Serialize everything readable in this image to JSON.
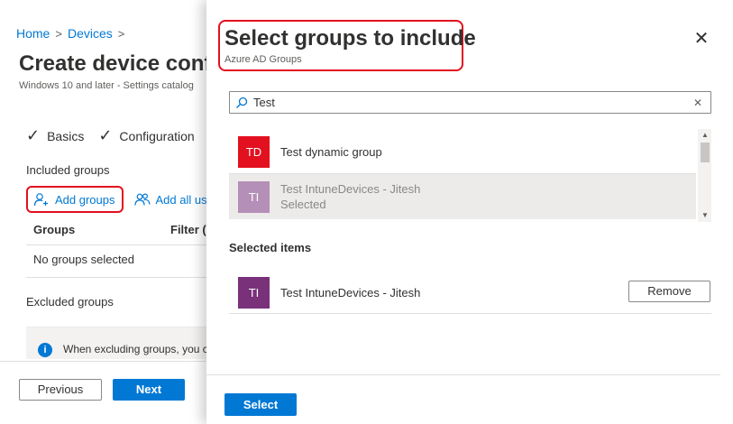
{
  "breadcrumb": {
    "home": "Home",
    "devices": "Devices",
    "sep": ">"
  },
  "page": {
    "title": "Create device confi",
    "subtitle": "Windows 10 and later - Settings catalog",
    "steps": [
      "Basics",
      "Configuration"
    ],
    "included_label": "Included groups",
    "add_groups_label": "Add groups",
    "add_all_label": "Add all use",
    "table_headers": [
      "Groups",
      "Filter (p"
    ],
    "no_groups_text": "No groups selected",
    "excluded_label": "Excluded groups",
    "info_text": "When excluding groups, you c",
    "previous_label": "Previous",
    "next_label": "Next"
  },
  "blade": {
    "title": "Select groups to include",
    "subtitle": "Azure AD Groups",
    "search": {
      "value": "Test",
      "placeholder": ""
    },
    "results": [
      {
        "initials": "TD",
        "name": "Test dynamic group",
        "status": "",
        "color": "#e3101f"
      },
      {
        "initials": "TI",
        "name": "Test IntuneDevices - Jitesh",
        "status": "Selected",
        "color": "#b48fb7"
      }
    ],
    "selected_label": "Selected items",
    "selected_items": [
      {
        "initials": "TI",
        "name": "Test IntuneDevices - Jitesh",
        "color": "#79317a"
      }
    ],
    "remove_label": "Remove",
    "select_label": "Select"
  },
  "colors": {
    "accent": "#0078d4",
    "highlight": "#e3101f"
  },
  "icons": {
    "close": "close-icon",
    "search": "search-icon",
    "clear": "clear-icon",
    "check": "checkmark-icon",
    "info": "info-icon",
    "add_person": "add-person-icon",
    "people": "people-icon"
  }
}
